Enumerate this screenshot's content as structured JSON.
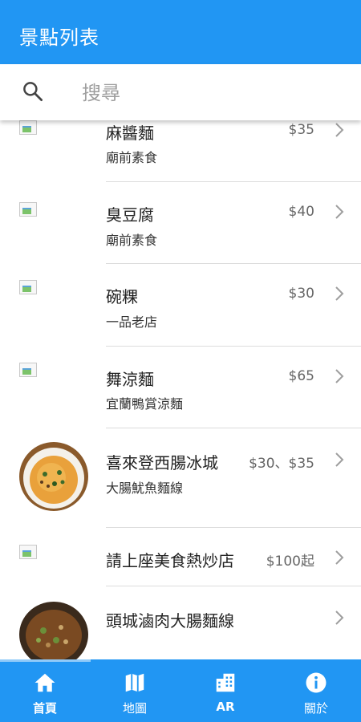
{
  "appbar": {
    "title": "景點列表"
  },
  "search": {
    "placeholder": "搜尋",
    "icon": "search-icon"
  },
  "items": [
    {
      "name": "麻醬麵",
      "sub": "廟前素食",
      "price": "$35",
      "thumb": "broken"
    },
    {
      "name": "臭豆腐",
      "sub": "廟前素食",
      "price": "$40",
      "thumb": "broken"
    },
    {
      "name": "碗粿",
      "sub": "一品老店",
      "price": "$30",
      "thumb": "broken"
    },
    {
      "name": "舞涼麵",
      "sub": "宜蘭鴨賞涼麵",
      "price": "$65",
      "thumb": "broken"
    },
    {
      "name": "喜來登西腸冰城",
      "sub": "大腸魷魚麵線",
      "price": "$30、$35",
      "thumb": "photo"
    },
    {
      "name": "請上座美食熱炒店",
      "sub": "",
      "price": "$100起",
      "thumb": "broken"
    },
    {
      "name": "頭城滷肉大腸麵線",
      "sub": "",
      "price": "",
      "thumb": "photo"
    }
  ],
  "tabs": [
    {
      "label": "首頁",
      "icon": "home-icon",
      "active": true
    },
    {
      "label": "地圖",
      "icon": "map-icon",
      "active": false
    },
    {
      "label": "AR",
      "icon": "building-icon",
      "active": false
    },
    {
      "label": "關於",
      "icon": "info-icon",
      "active": false
    }
  ],
  "colors": {
    "primary": "#2196f3",
    "divider": "#dcdcdc",
    "price": "#666666"
  }
}
